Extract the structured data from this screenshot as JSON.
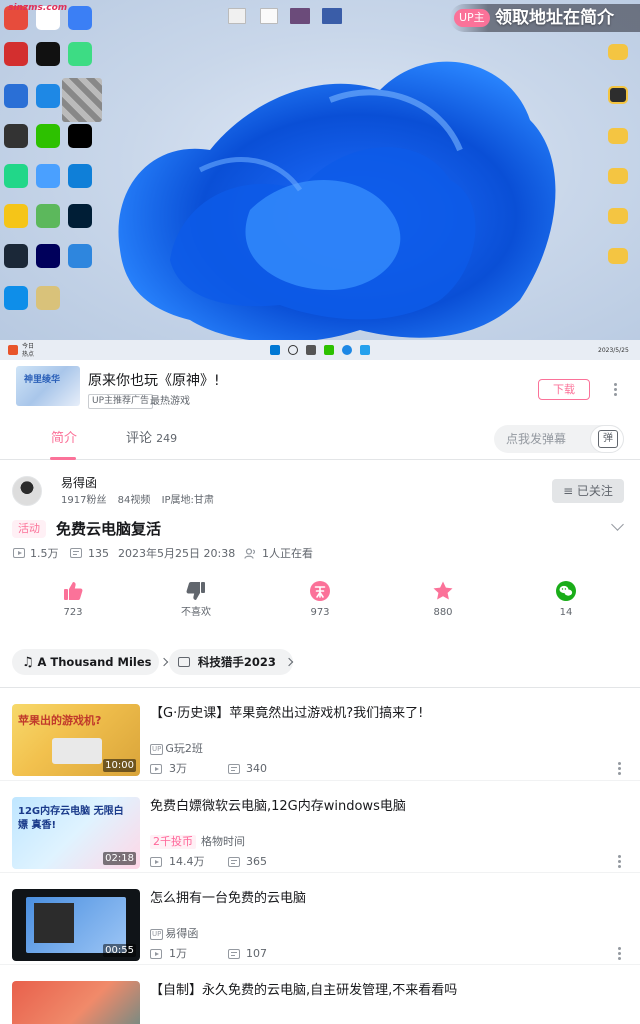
{
  "video": {
    "watermark": "sinzms.com",
    "up_banner": {
      "tag": "UP主",
      "text": "领取地址在简介"
    },
    "taskbar": {
      "weather_line1": "今日",
      "weather_line2": "热点",
      "date": "2023/5/25"
    }
  },
  "ad": {
    "thumb_text": "神里绫华",
    "title": "原来你也玩《原神》!",
    "badge": "UP主推荐广告",
    "subtitle": "最热游戏",
    "button": "下载"
  },
  "tabs": {
    "intro": "简介",
    "comments_label": "评论",
    "comments_count": "249",
    "danmaku_placeholder": "点我发弹幕",
    "danmaku_glyph": "弹"
  },
  "uploader": {
    "name": "易得函",
    "fans": "1917粉丝",
    "videos": "84视频",
    "ip": "IP属地:甘肃",
    "follow_label": "≡ 已关注"
  },
  "video_info": {
    "tag": "活动",
    "title": "免费云电脑复活",
    "plays": "1.5万",
    "danmaku": "135",
    "date": "2023年5月25日 20:38",
    "viewers": "1人正在看"
  },
  "actions": [
    {
      "icon": "thumbs-up-icon",
      "label": "723",
      "color": "#fb7299"
    },
    {
      "icon": "thumbs-down-icon",
      "label": "不喜欢",
      "color": "#61666d"
    },
    {
      "icon": "coin-icon",
      "label": "973",
      "color": "#fb7299"
    },
    {
      "icon": "star-icon",
      "label": "880",
      "color": "#fb7299"
    },
    {
      "icon": "wechat-icon",
      "label": "14",
      "color": "#1aad19"
    }
  ],
  "chips": [
    {
      "icon": "music-note-icon",
      "label": "A Thousand Miles"
    },
    {
      "icon": "tv-icon",
      "label": "科技猎手2023"
    }
  ],
  "related": [
    {
      "title": "【G·历史课】苹果竟然出过游戏机?我们搞来了!",
      "owner": "G玩2班",
      "coin": "",
      "plays": "3万",
      "danmaku": "340",
      "duration": "10:00",
      "thumb_text": "苹果出的游戏机?"
    },
    {
      "title": "免费白嫖微软云电脑,12G内存windows电脑",
      "owner": "格物时间",
      "coin": "2千投币",
      "plays": "14.4万",
      "danmaku": "365",
      "duration": "02:18",
      "thumb_text": "12G内存云电脑 无限白嫖 真香!"
    },
    {
      "title": "怎么拥有一台免费的云电脑",
      "owner": "易得函",
      "coin": "",
      "plays": "1万",
      "danmaku": "107",
      "duration": "00:55",
      "thumb_text": ""
    },
    {
      "title": "【自制】永久免费的云电脑,自主研发管理,不来看看吗",
      "owner": "",
      "coin": "",
      "plays": "",
      "danmaku": "",
      "duration": "",
      "thumb_text": ""
    }
  ],
  "colors": {
    "brand_pink": "#fb7299",
    "text_main": "#18191c",
    "text_sub": "#61666d",
    "wechat_green": "#1aad19"
  }
}
